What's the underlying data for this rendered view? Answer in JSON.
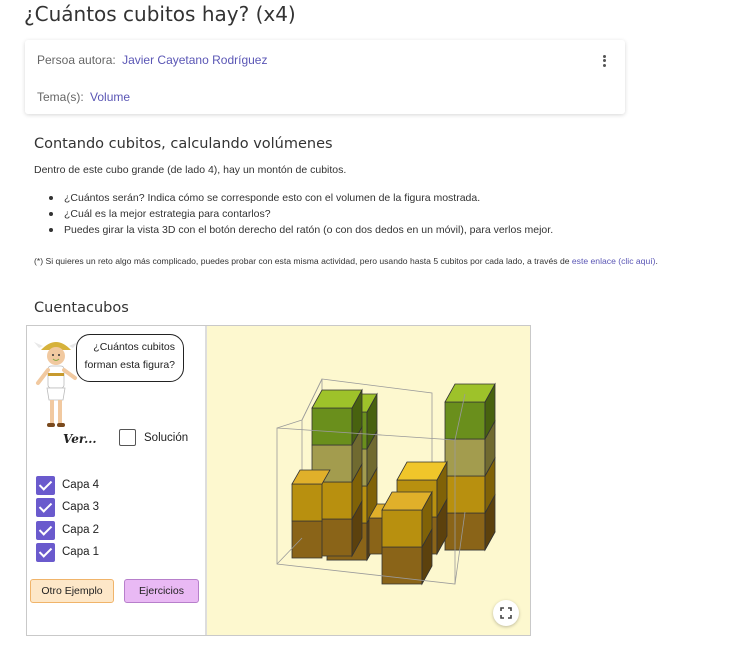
{
  "page": {
    "title": "¿Cuántos cubitos hay? (x4)"
  },
  "meta": {
    "author_label": "Persoa autora:",
    "author_name": "Javier Cayetano Rodríguez",
    "topic_label": "Tema(s):",
    "topic_name": "Volume",
    "menu_icon": "kebab-menu-icon"
  },
  "section1": {
    "title": "Contando cubitos, calculando volúmenes",
    "intro": "Dentro de este cubo grande (de lado 4), hay un montón de cubitos.",
    "bullets": [
      "¿Cuántos serán? Indica cómo se corresponde esto con el volumen de la figura mostrada.",
      "¿Cuál es la mejor estrategia para contarlos?",
      "Puedes girar la vista 3D con el botón derecho del ratón (o con dos dedos en un móvil), para verlos mejor."
    ],
    "note_text": "(*) Si quieres un reto algo más complicado, puedes probar con esta misma actividad, pero usando hasta 5 cubitos por cada lado, a través de ",
    "note_link": "este enlace (clic aquí)",
    "note_end": "."
  },
  "section2": {
    "title": "Cuentacubos"
  },
  "applet": {
    "bubble_line1": "¿Cuántos cubitos",
    "bubble_line2": "forman esta figura?",
    "ver_label": "Ver...",
    "solution_label": "Solución",
    "solution_checked": false,
    "layers": [
      {
        "label": "Capa 4",
        "checked": true
      },
      {
        "label": "Capa 3",
        "checked": true
      },
      {
        "label": "Capa 2",
        "checked": true
      },
      {
        "label": "Capa 1",
        "checked": true
      }
    ],
    "btn_otro": "Otro Ejemplo",
    "btn_ejercicios": "Ejercicios",
    "fullscreen_icon": "fullscreen-icon",
    "colors": {
      "view_bg": "#fdf8cf",
      "checkbox": "#6a5acd",
      "otro_bg": "#fde7c8",
      "ejercicios_bg": "#e9b9f4",
      "layer1": "#8a6418",
      "layer2": "#b8900f",
      "layer3": "#a39c4e",
      "layer4": "#6a8f1c"
    }
  }
}
